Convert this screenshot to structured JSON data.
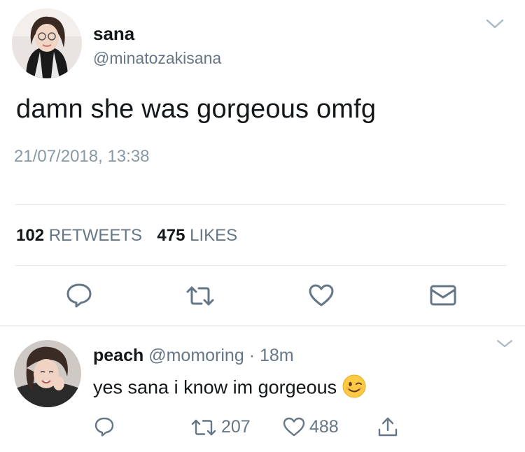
{
  "tweet": {
    "author_name": "sana",
    "author_handle": "@minatozakisana",
    "text": "damn she was gorgeous omfg",
    "timestamp": "21/07/2018, 13:38",
    "retweets_count": "102",
    "retweets_label": "RETWEETS",
    "likes_count": "475",
    "likes_label": "LIKES",
    "icons": [
      "reply-icon",
      "retweet-icon",
      "like-icon",
      "share-dm-icon"
    ]
  },
  "reply": {
    "author_name": "peach",
    "author_handle": "@momoring",
    "separator": "·",
    "time": "18m",
    "text": "yes sana i know im gorgeous",
    "emoji": "winking-face",
    "retweets_count": "207",
    "likes_count": "488",
    "icons": [
      "reply-icon",
      "retweet-icon",
      "like-icon",
      "share-icon"
    ]
  },
  "colors": {
    "primary_text": "#14171a",
    "secondary_text": "#657786",
    "timestamp_text": "#8899a6",
    "divider": "#e1e8ed",
    "icon": "#657786",
    "chevron": "#aab8c2"
  }
}
